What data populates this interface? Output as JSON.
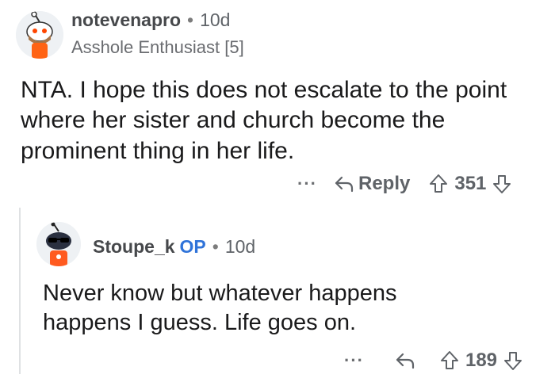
{
  "comments": [
    {
      "username": "notevenapro",
      "separator": "•",
      "time": "10d",
      "flair": "Asshole Enthusiast [5]",
      "body": "NTA.  I hope this does not escalate to the point where her sister and church become the prominent thing in her life.",
      "more": "···",
      "reply_label": "Reply",
      "score": "351",
      "avatar_icon": "snoo-avatar-icon"
    },
    {
      "username": "Stoupe_k",
      "op_badge": "OP",
      "separator": "•",
      "time": "10d",
      "body": "Never know but whatever happens happens I guess. Life goes on.",
      "more": "···",
      "score": "189",
      "avatar_icon": "snoo-avatar-icon"
    }
  ],
  "colors": {
    "op": "#2f73d9",
    "text": "#1a1a1b",
    "muted": "#5f6368",
    "thread_line": "#dfe1e3"
  }
}
